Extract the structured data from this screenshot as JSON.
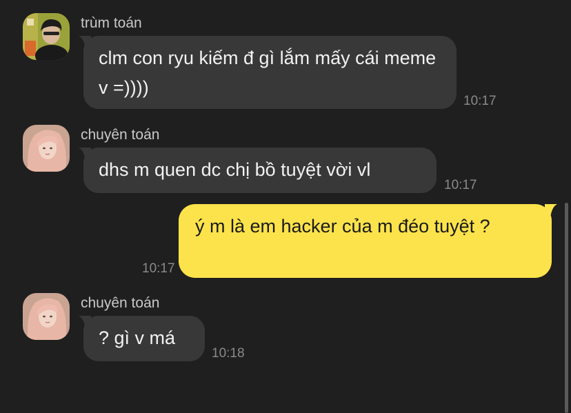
{
  "messages": [
    {
      "sender": "trùm toán",
      "avatar_icon": "avatar-trum-toan",
      "text": "clm con ryu kiếm đ gì lắm mấy cái meme v =))))",
      "time": "10:17",
      "outgoing": false
    },
    {
      "sender": "chuyên toán",
      "avatar_icon": "avatar-chuyen-toan",
      "text": "dhs m quen dc chị bồ tuyệt vời vl",
      "time": "10:17",
      "outgoing": false
    },
    {
      "sender": "",
      "text": "ý m là em hacker của m đéo tuyệt ?",
      "time": "10:17",
      "outgoing": true
    },
    {
      "sender": "chuyên toán",
      "avatar_icon": "avatar-chuyen-toan",
      "text": "? gì v má",
      "time": "10:18",
      "outgoing": false
    }
  ],
  "colors": {
    "background": "#1f1f1f",
    "incoming_bubble": "#383838",
    "outgoing_bubble": "#fde34b",
    "sender_text": "#c9c9c9",
    "timestamp_text": "#8a8a8a"
  }
}
